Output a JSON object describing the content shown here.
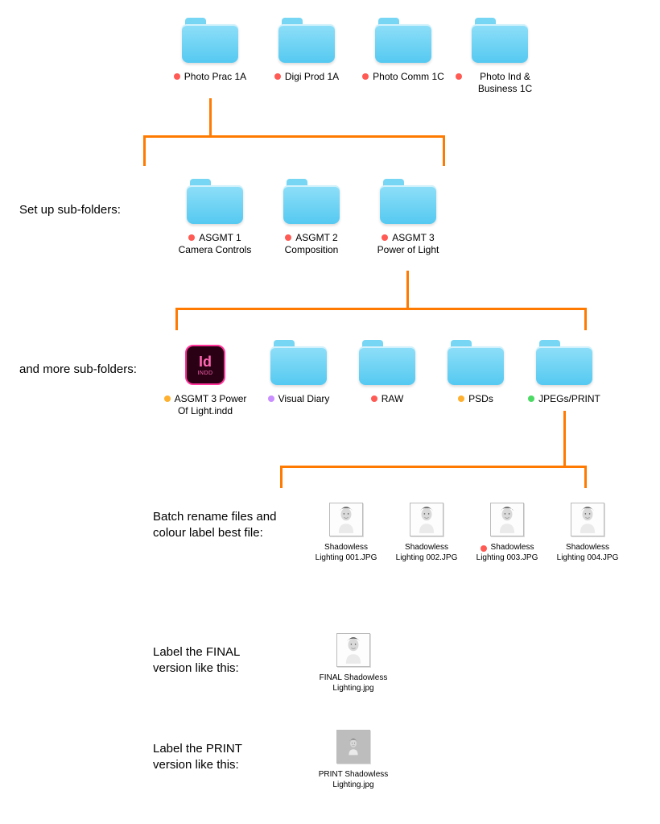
{
  "row1": {
    "folders": [
      {
        "label": "Photo Prac 1A",
        "dot": "red"
      },
      {
        "label": "Digi Prod 1A",
        "dot": "red"
      },
      {
        "label": "Photo Comm 1C",
        "dot": "red"
      },
      {
        "label": "Photo Ind & Business 1C",
        "dot": "red"
      }
    ]
  },
  "row2": {
    "heading": "Set up sub-folders:",
    "folders": [
      {
        "line1": "ASGMT 1",
        "line2": "Camera Controls",
        "dot": "red"
      },
      {
        "line1": "ASGMT 2",
        "line2": "Composition",
        "dot": "red"
      },
      {
        "line1": "ASGMT 3",
        "line2": "Power of Light",
        "dot": "red"
      }
    ]
  },
  "row3": {
    "heading": "and more sub-folders:",
    "items": [
      {
        "kind": "indd",
        "line1": "ASGMT 3 Power",
        "line2": "Of Light.indd",
        "dot": "orange",
        "indd_big": "Id",
        "indd_small": "INDD"
      },
      {
        "kind": "folder",
        "line1": "Visual Diary",
        "dot": "purple"
      },
      {
        "kind": "folder",
        "line1": "RAW",
        "dot": "red"
      },
      {
        "kind": "folder",
        "line1": "PSDs",
        "dot": "orange"
      },
      {
        "kind": "folder",
        "line1": "JPEGs/PRINT",
        "dot": "green"
      }
    ]
  },
  "row4": {
    "heading": "Batch rename files and colour label best file:",
    "files": [
      {
        "line1": "Shadowless",
        "line2": "Lighting 001.JPG"
      },
      {
        "line1": "Shadowless",
        "line2": "Lighting 002.JPG"
      },
      {
        "line1": "Shadowless",
        "line2": "Lighting 003.JPG",
        "dot": "red"
      },
      {
        "line1": "Shadowless",
        "line2": "Lighting 004.JPG"
      }
    ]
  },
  "final": {
    "heading": "Label the FINAL version like this:",
    "line1": "FINAL Shadowless",
    "line2": "Lighting.jpg"
  },
  "print": {
    "heading": "Label the PRINT version like this:",
    "line1": "PRINT Shadowless",
    "line2": "Lighting.jpg"
  }
}
